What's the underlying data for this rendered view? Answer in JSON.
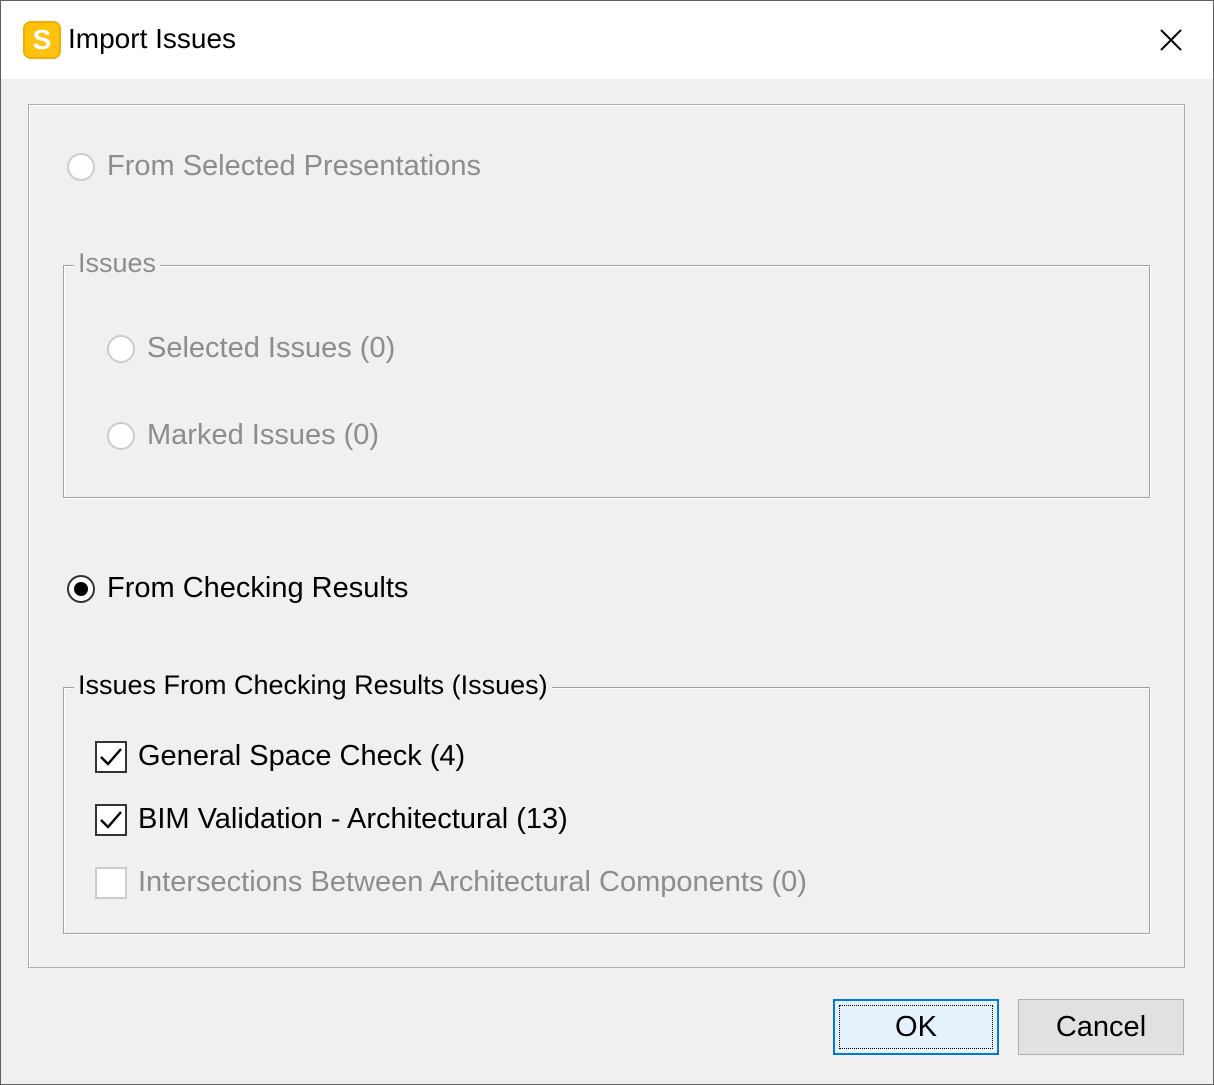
{
  "window": {
    "title": "Import Issues",
    "app_icon_letter": "S",
    "accent_color": "#ffc20e",
    "close_icon": "close-icon"
  },
  "options": {
    "from_selected_presentations": {
      "label": "From Selected Presentations",
      "selected": false,
      "enabled": false
    },
    "issues_group": {
      "legend": "Issues",
      "selected_issues": {
        "label": "Selected Issues (0)",
        "enabled": false
      },
      "marked_issues": {
        "label": "Marked Issues (0)",
        "enabled": false
      }
    },
    "from_checking_results": {
      "label": "From Checking Results",
      "selected": true,
      "enabled": true
    },
    "checking_group": {
      "legend": "Issues From Checking Results (Issues)",
      "items": [
        {
          "label": "General Space Check (4)",
          "checked": true,
          "enabled": true
        },
        {
          "label": "BIM Validation - Architectural (13)",
          "checked": true,
          "enabled": true
        },
        {
          "label": "Intersections Between Architectural Components (0)",
          "checked": false,
          "enabled": false
        }
      ]
    }
  },
  "buttons": {
    "ok_label": "OK",
    "cancel_label": "Cancel"
  }
}
